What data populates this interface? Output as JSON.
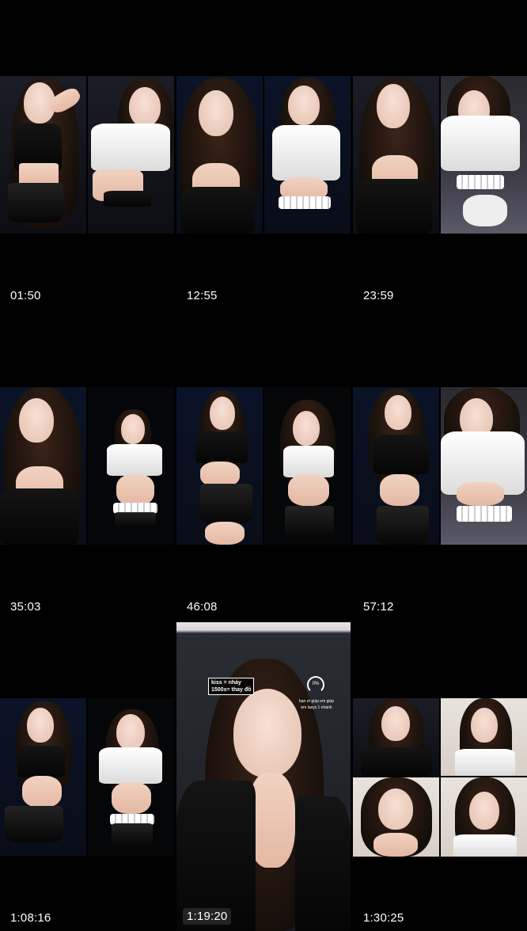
{
  "tiles": [
    {
      "time": "01:50"
    },
    {
      "time": "12:55"
    },
    {
      "time": "23:59"
    },
    {
      "time": "35:03"
    },
    {
      "time": "46:08"
    },
    {
      "time": "57:12"
    },
    {
      "time": "1:08:16"
    },
    {
      "time": "1:19:20"
    },
    {
      "time": "1:30:25"
    }
  ],
  "overlay": {
    "line1": "kiss = nhảy",
    "line2": "1500x= thay đồ",
    "badge": "0%",
    "caption1": "bạn ơi giúp em giúp",
    "caption2": "em lasys 1 nhánh"
  },
  "colors": {
    "background": "#000000",
    "tile_divider": "#1a1a1a",
    "timestamp": "#ffffff"
  }
}
